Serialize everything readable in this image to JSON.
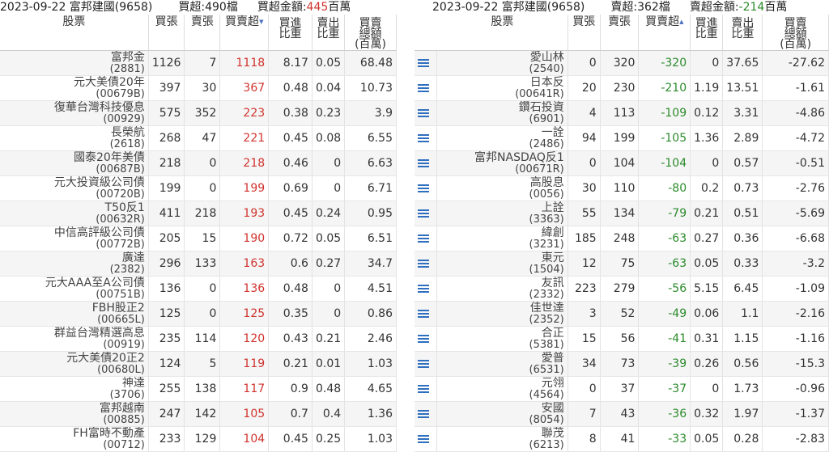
{
  "left": {
    "date": "2023-09-22 富邦建國(9658)",
    "summary_label": "買超:490檔",
    "amount_label": "買超金額:",
    "amount_value": "445",
    "amount_unit": "百萬",
    "headers": {
      "stock": "股票",
      "buy": "買張",
      "sell": "賣張",
      "net": "買賣超",
      "buy_ratio": [
        "買進",
        "比重"
      ],
      "sell_ratio": [
        "賣出",
        "比重"
      ],
      "amount": [
        "買賣",
        "總額",
        "(百萬)"
      ]
    },
    "rows": [
      {
        "name": "富邦金",
        "code": "(2881)",
        "buy": "1126",
        "sell": "7",
        "net": "1118",
        "br": "8.17",
        "sr": "0.05",
        "amt": "68.48"
      },
      {
        "name": "元大美債20年",
        "code": "(00679B)",
        "buy": "397",
        "sell": "30",
        "net": "367",
        "br": "0.48",
        "sr": "0.04",
        "amt": "10.73"
      },
      {
        "name": "復華台灣科技優息",
        "code": "(00929)",
        "buy": "575",
        "sell": "352",
        "net": "223",
        "br": "0.38",
        "sr": "0.23",
        "amt": "3.9"
      },
      {
        "name": "長榮航",
        "code": "(2618)",
        "buy": "268",
        "sell": "47",
        "net": "221",
        "br": "0.45",
        "sr": "0.08",
        "amt": "6.55"
      },
      {
        "name": "國泰20年美債",
        "code": "(00687B)",
        "buy": "218",
        "sell": "0",
        "net": "218",
        "br": "0.46",
        "sr": "0",
        "amt": "6.63"
      },
      {
        "name": "元大投資級公司債",
        "code": "(00720B)",
        "buy": "199",
        "sell": "0",
        "net": "199",
        "br": "0.69",
        "sr": "0",
        "amt": "6.71"
      },
      {
        "name": "T50反1",
        "code": "(00632R)",
        "buy": "411",
        "sell": "218",
        "net": "193",
        "br": "0.45",
        "sr": "0.24",
        "amt": "0.95"
      },
      {
        "name": "中信高評級公司債",
        "code": "(00772B)",
        "buy": "205",
        "sell": "15",
        "net": "190",
        "br": "0.72",
        "sr": "0.05",
        "amt": "6.51"
      },
      {
        "name": "廣達",
        "code": "(2382)",
        "buy": "296",
        "sell": "133",
        "net": "163",
        "br": "0.6",
        "sr": "0.27",
        "amt": "34.7"
      },
      {
        "name": "元大AAA至A公司債",
        "code": "(00751B)",
        "buy": "136",
        "sell": "0",
        "net": "136",
        "br": "0.48",
        "sr": "0",
        "amt": "4.51"
      },
      {
        "name": "FBH股正2",
        "code": "(00665L)",
        "buy": "125",
        "sell": "0",
        "net": "125",
        "br": "0.35",
        "sr": "0",
        "amt": "0.86"
      },
      {
        "name": "群益台灣精選高息",
        "code": "(00919)",
        "buy": "235",
        "sell": "114",
        "net": "120",
        "br": "0.43",
        "sr": "0.21",
        "amt": "2.46"
      },
      {
        "name": "元大美債20正2",
        "code": "(00680L)",
        "buy": "124",
        "sell": "5",
        "net": "119",
        "br": "0.21",
        "sr": "0.01",
        "amt": "1.03"
      },
      {
        "name": "神達",
        "code": "(3706)",
        "buy": "255",
        "sell": "138",
        "net": "117",
        "br": "0.9",
        "sr": "0.48",
        "amt": "4.65"
      },
      {
        "name": "富邦越南",
        "code": "(00885)",
        "buy": "247",
        "sell": "142",
        "net": "105",
        "br": "0.7",
        "sr": "0.4",
        "amt": "1.36"
      },
      {
        "name": "FH富時不動產",
        "code": "(00712)",
        "buy": "233",
        "sell": "129",
        "net": "104",
        "br": "0.45",
        "sr": "0.25",
        "amt": "1.03"
      }
    ]
  },
  "right": {
    "date": "2023-09-22 富邦建國(9658)",
    "summary_label": "賣超:362檔",
    "amount_label": "賣超金額:",
    "amount_value": "-214",
    "amount_unit": "百萬",
    "headers": {
      "stock": "股票",
      "buy": "買張",
      "sell": "賣張",
      "net": "買賣超",
      "buy_ratio": [
        "買進",
        "比重"
      ],
      "sell_ratio": [
        "賣出",
        "比重"
      ],
      "amount": [
        "買賣",
        "總額",
        "(百萬)"
      ]
    },
    "rows": [
      {
        "name": "愛山林",
        "code": "(2540)",
        "buy": "0",
        "sell": "320",
        "net": "-320",
        "br": "0",
        "sr": "37.65",
        "amt": "-27.62"
      },
      {
        "name": "日本反",
        "code": "(00641R)",
        "buy": "20",
        "sell": "230",
        "net": "-210",
        "br": "1.19",
        "sr": "13.51",
        "amt": "-1.61"
      },
      {
        "name": "鑽石投資",
        "code": "(6901)",
        "buy": "4",
        "sell": "113",
        "net": "-109",
        "br": "0.12",
        "sr": "3.31",
        "amt": "-4.86"
      },
      {
        "name": "一詮",
        "code": "(2486)",
        "buy": "94",
        "sell": "199",
        "net": "-105",
        "br": "1.36",
        "sr": "2.89",
        "amt": "-4.72"
      },
      {
        "name": "富邦NASDAQ反1",
        "code": "(00671R)",
        "buy": "0",
        "sell": "104",
        "net": "-104",
        "br": "0",
        "sr": "0.57",
        "amt": "-0.51"
      },
      {
        "name": "高股息",
        "code": "(0056)",
        "buy": "30",
        "sell": "110",
        "net": "-80",
        "br": "0.2",
        "sr": "0.73",
        "amt": "-2.76"
      },
      {
        "name": "上詮",
        "code": "(3363)",
        "buy": "55",
        "sell": "134",
        "net": "-79",
        "br": "0.21",
        "sr": "0.51",
        "amt": "-5.69"
      },
      {
        "name": "緯創",
        "code": "(3231)",
        "buy": "185",
        "sell": "248",
        "net": "-63",
        "br": "0.27",
        "sr": "0.36",
        "amt": "-6.68"
      },
      {
        "name": "東元",
        "code": "(1504)",
        "buy": "12",
        "sell": "75",
        "net": "-63",
        "br": "0.05",
        "sr": "0.33",
        "amt": "-3.2"
      },
      {
        "name": "友訊",
        "code": "(2332)",
        "buy": "223",
        "sell": "279",
        "net": "-56",
        "br": "5.15",
        "sr": "6.45",
        "amt": "-1.09"
      },
      {
        "name": "佳世達",
        "code": "(2352)",
        "buy": "3",
        "sell": "52",
        "net": "-49",
        "br": "0.06",
        "sr": "1.1",
        "amt": "-2.16"
      },
      {
        "name": "合正",
        "code": "(5381)",
        "buy": "15",
        "sell": "56",
        "net": "-41",
        "br": "0.31",
        "sr": "1.15",
        "amt": "-1.16"
      },
      {
        "name": "愛普",
        "code": "(6531)",
        "buy": "34",
        "sell": "73",
        "net": "-39",
        "br": "0.26",
        "sr": "0.56",
        "amt": "-15.3"
      },
      {
        "name": "元翎",
        "code": "(4564)",
        "buy": "0",
        "sell": "37",
        "net": "-37",
        "br": "0",
        "sr": "1.73",
        "amt": "-0.96"
      },
      {
        "name": "安國",
        "code": "(8054)",
        "buy": "7",
        "sell": "43",
        "net": "-36",
        "br": "0.32",
        "sr": "1.97",
        "amt": "-1.37"
      },
      {
        "name": "聯茂",
        "code": "(6213)",
        "buy": "8",
        "sell": "41",
        "net": "-33",
        "br": "0.05",
        "sr": "0.28",
        "amt": "-2.83"
      }
    ]
  },
  "icons": {
    "row_menu": "list-icon",
    "sort": "sort-desc-icon"
  },
  "colors": {
    "positive": "#d0332e",
    "negative": "#2a8a2a",
    "icon": "#2f6fbf"
  }
}
